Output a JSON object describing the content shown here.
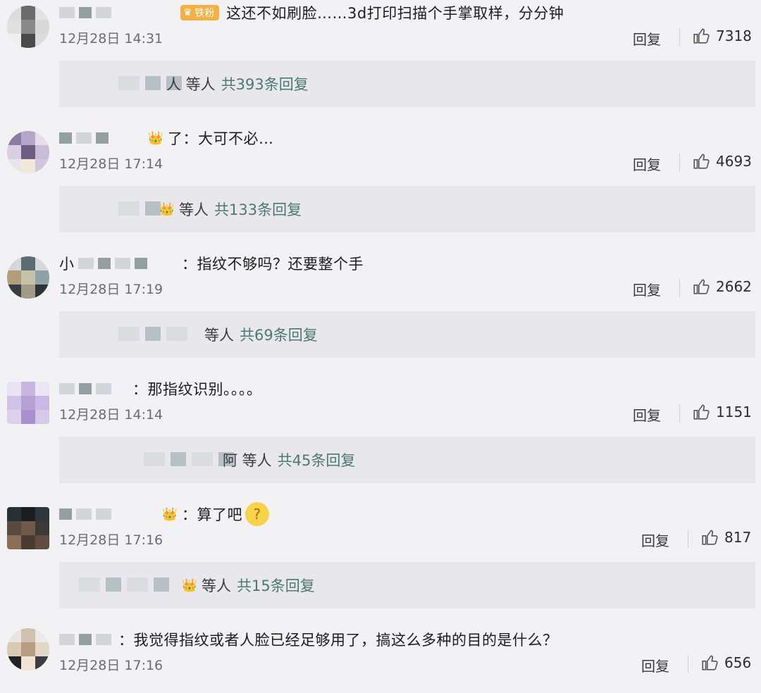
{
  "comments": [
    {
      "badge": "铁粉",
      "text": "这还不如刷脸……3d打印扫描个手掌取样，分分钟",
      "time": "12月28日 14:31",
      "reply": "回复",
      "likes": "7318",
      "thread_prefix": "人 等人",
      "thread_count": "共393条回复"
    },
    {
      "text": "了：大可不必…",
      "time": "12月28日 17:14",
      "reply": "回复",
      "likes": "4693",
      "thread_prefix": "等人",
      "thread_count": "共133条回复"
    },
    {
      "name_start": "小",
      "text": "：指纹不够吗？还要整个手",
      "time": "12月28日 17:19",
      "reply": "回复",
      "likes": "2662",
      "thread_prefix": "等人",
      "thread_count": "共69条回复"
    },
    {
      "text": "：那指纹识别。。。。",
      "time": "12月28日 14:14",
      "reply": "回复",
      "likes": "1151",
      "thread_prefix": "阿 等人",
      "thread_count": "共45条回复"
    },
    {
      "text": "：算了吧",
      "time": "12月28日 17:16",
      "reply": "回复",
      "likes": "817",
      "thread_prefix": "等人",
      "thread_count": "共15条回复"
    },
    {
      "text": "：我觉得指纹或者人脸已经足够用了，搞这么多种的目的是什么？",
      "time": "12月28日 17:16",
      "reply": "回复",
      "likes": "656"
    }
  ],
  "icons": {
    "like": "thumbs-up-icon",
    "fan": "fan-emoji-icon",
    "thinking": "thinking-emoji-icon",
    "fan_badge": "fan-badge-icon"
  },
  "colors": {
    "background": "#f2f2f4",
    "subreply_bg": "#e8e8ec",
    "count_green": "#4b7a6b",
    "badge_orange": "#f5b043",
    "emoji_red": "#e7492f"
  }
}
